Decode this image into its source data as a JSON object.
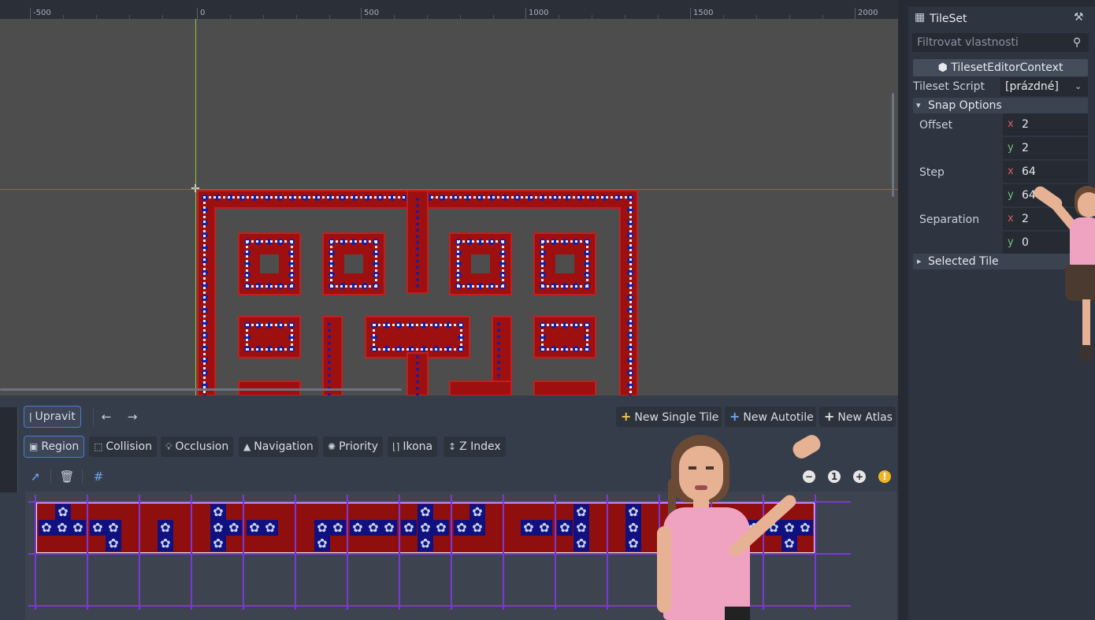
{
  "viewport": {
    "ruler_labels": [
      "-500",
      "0",
      "500",
      "1000",
      "1500",
      "2000"
    ]
  },
  "toolbar": {
    "edit_label": "Upravit",
    "back_icon": "arrow-left-icon",
    "forward_icon": "arrow-right-icon",
    "new_single_tile": "New Single Tile",
    "new_autotile": "New Autotile",
    "new_atlas": "New Atlas"
  },
  "modes": {
    "region": "Region",
    "collision": "Collision",
    "occlusion": "Occlusion",
    "navigation": "Navigation",
    "priority": "Priority",
    "icon": "Ikona",
    "z_index": "Z Index"
  },
  "zoom": {
    "minus": "−",
    "reset": "1",
    "plus": "+",
    "info": "!"
  },
  "inspector": {
    "title": "TileSet",
    "filter_placeholder": "Filtrovat vlastnosti",
    "context_button": "TilesetEditorContext",
    "script_label": "Tileset Script",
    "script_value": "[prázdné]",
    "snap_options_label": "Snap Options",
    "offset_label": "Offset",
    "offset_x": "2",
    "offset_y": "2",
    "step_label": "Step",
    "step_x": "64",
    "step_y": "64",
    "separation_label": "Separation",
    "separation_x": "2",
    "separation_y": "0",
    "selected_tile_label": "Selected Tile",
    "axis_x": "x",
    "axis_y": "y"
  },
  "colors": {
    "wall": "#9e0f0f",
    "dots": "#1a1fa0",
    "grid": "#7b38d8",
    "guide_v": "#8dc63f",
    "guide_h": "#d64545"
  }
}
